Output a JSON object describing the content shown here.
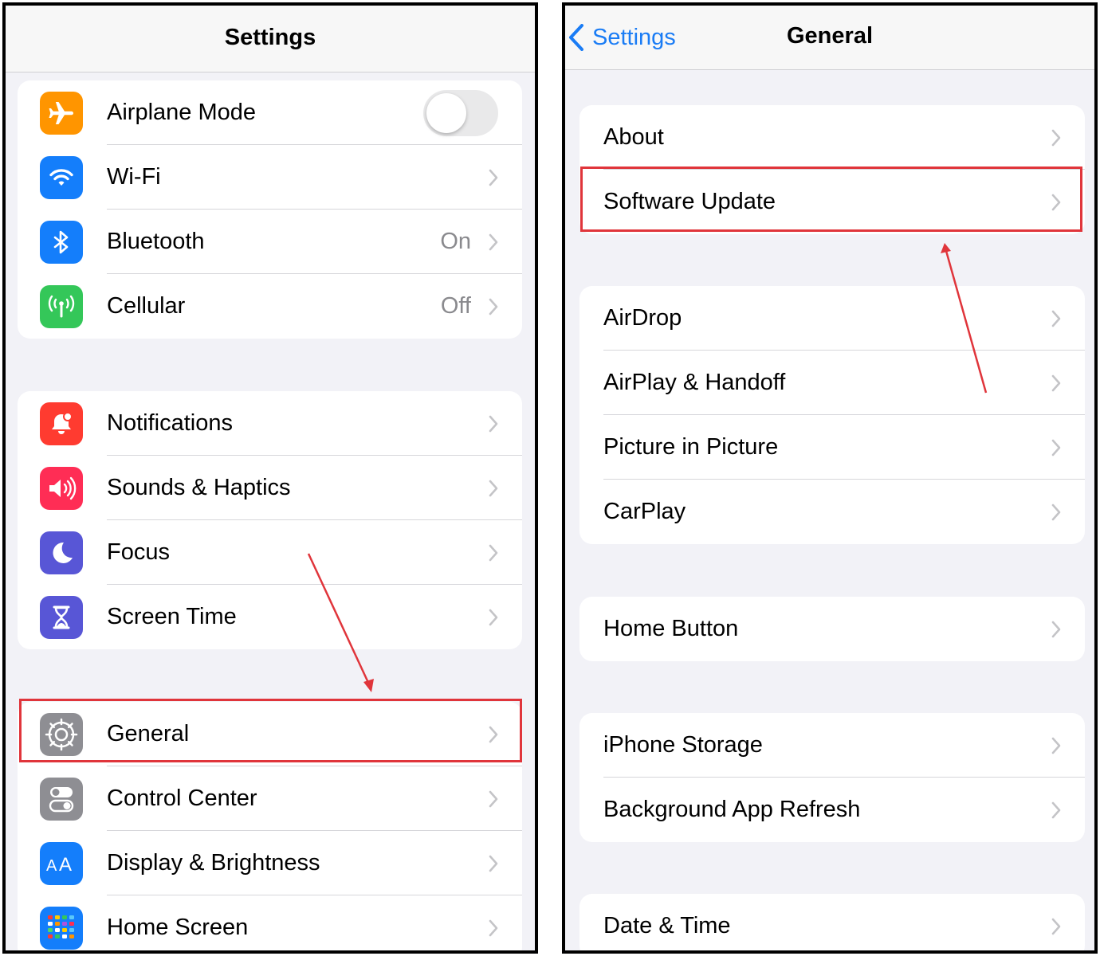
{
  "left_screen": {
    "title": "Settings",
    "groups": [
      [
        {
          "label": "Airplane Mode",
          "icon": "airplane-icon",
          "color": "#ff9500",
          "accessory": "toggle",
          "toggle_on": false
        },
        {
          "label": "Wi-Fi",
          "icon": "wifi-icon",
          "color": "#147efb",
          "accessory": "chevron"
        },
        {
          "label": "Bluetooth",
          "icon": "bluetooth-icon",
          "color": "#147efb",
          "value": "On",
          "accessory": "chevron"
        },
        {
          "label": "Cellular",
          "icon": "cellular-icon",
          "color": "#34c759",
          "value": "Off",
          "accessory": "chevron"
        }
      ],
      [
        {
          "label": "Notifications",
          "icon": "notifications-icon",
          "color": "#ff3b30",
          "accessory": "chevron"
        },
        {
          "label": "Sounds & Haptics",
          "icon": "speaker-icon",
          "color": "#ff2d55",
          "accessory": "chevron"
        },
        {
          "label": "Focus",
          "icon": "moon-icon",
          "color": "#5856d6",
          "accessory": "chevron"
        },
        {
          "label": "Screen Time",
          "icon": "hourglass-icon",
          "color": "#5856d6",
          "accessory": "chevron"
        }
      ],
      [
        {
          "label": "General",
          "icon": "gear-icon",
          "color": "#8e8e93",
          "accessory": "chevron"
        },
        {
          "label": "Control Center",
          "icon": "switches-icon",
          "color": "#8e8e93",
          "accessory": "chevron"
        },
        {
          "label": "Display & Brightness",
          "icon": "text-size-icon",
          "color": "#147efb",
          "accessory": "chevron"
        },
        {
          "label": "Home Screen",
          "icon": "home-screen-grid-icon",
          "color": "#147efb",
          "accessory": "chevron"
        }
      ]
    ],
    "highlighted_item": "General"
  },
  "right_screen": {
    "title": "General",
    "back_label": "Settings",
    "groups": [
      [
        {
          "label": "About"
        },
        {
          "label": "Software Update"
        }
      ],
      [
        {
          "label": "AirDrop"
        },
        {
          "label": "AirPlay & Handoff"
        },
        {
          "label": "Picture in Picture"
        },
        {
          "label": "CarPlay"
        }
      ],
      [
        {
          "label": "Home Button"
        }
      ],
      [
        {
          "label": "iPhone Storage"
        },
        {
          "label": "Background App Refresh"
        }
      ],
      [
        {
          "label": "Date & Time"
        }
      ]
    ],
    "highlighted_item": "Software Update"
  },
  "colors": {
    "accent": "#1a7cf5",
    "highlight": "#e0353b",
    "background": "#f2f2f7",
    "secondary_text": "#8a8a8e"
  }
}
